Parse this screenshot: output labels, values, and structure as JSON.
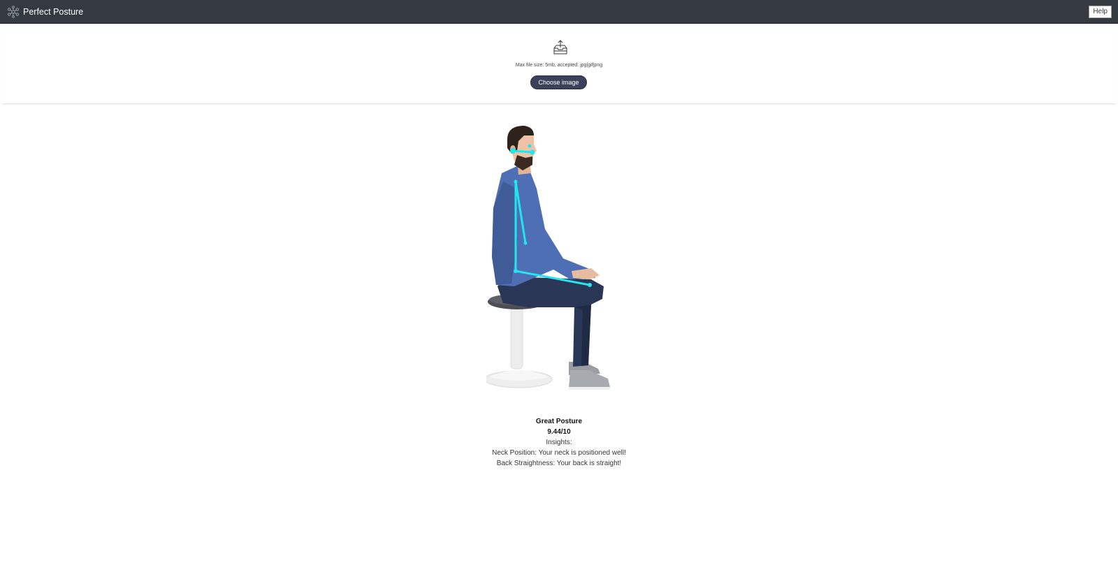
{
  "navbar": {
    "brand_name": "Perfect Posture",
    "brand_icon": "molecule-network-icon",
    "help_label": "Help",
    "background_color": "#343a40"
  },
  "upload": {
    "icon": "upload-tray-icon",
    "max_file_text": "Max file size: 5mb, accepted: jpg|gif|png",
    "choose_button_label": "Choose image",
    "button_color": "#3c4058"
  },
  "photo": {
    "description_icon": "posture-photo",
    "overlay_color": "#22e5ee"
  },
  "results": {
    "rating": "Great Posture",
    "score": "9.44/10",
    "insights_heading": "Insights:",
    "insights": [
      "Neck Position: Your neck is positioned well!",
      "Back Straightness: Your back is straight!"
    ]
  }
}
